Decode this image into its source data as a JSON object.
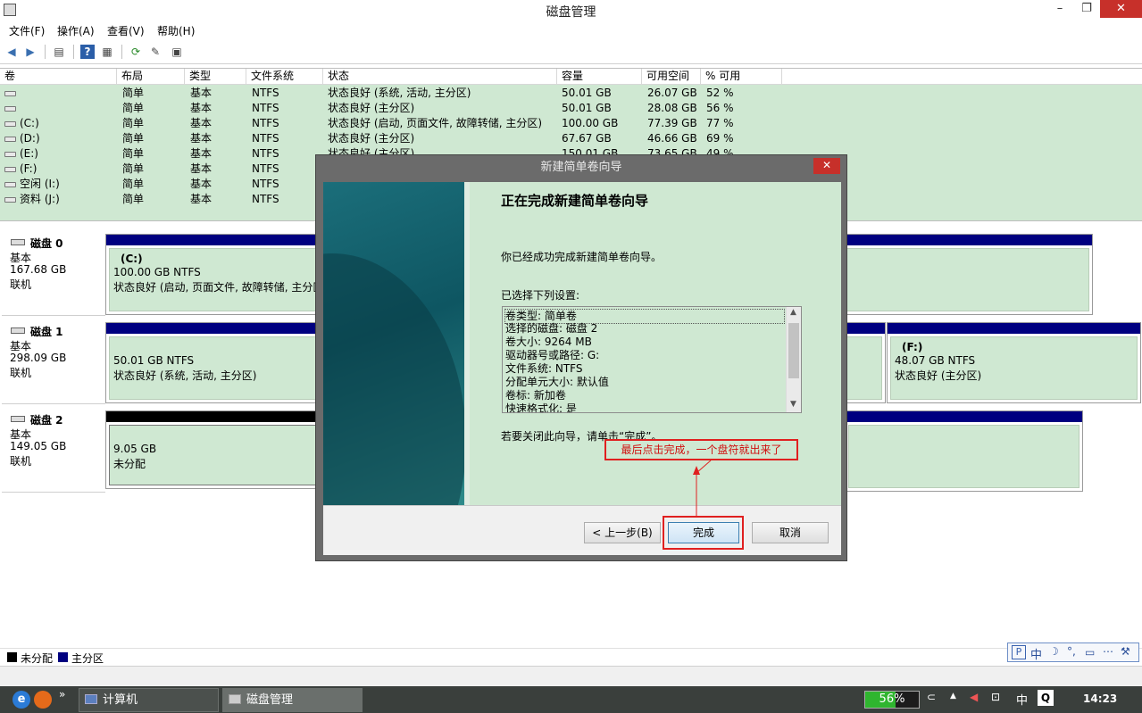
{
  "window": {
    "title": "磁盘管理",
    "minimize": "–",
    "restore": "❐",
    "close": "✕"
  },
  "menu": [
    "文件(F)",
    "操作(A)",
    "查看(V)",
    "帮助(H)"
  ],
  "toolbar_icons": [
    "back-icon",
    "forward-icon",
    "show-hide-console-tree-icon",
    "help-icon",
    "properties-icon",
    "refresh-icon",
    "export-icon",
    "properties-list-icon"
  ],
  "volume_table": {
    "columns": [
      "卷",
      "布局",
      "类型",
      "文件系统",
      "状态",
      "容量",
      "可用空间",
      "% 可用"
    ],
    "rows": [
      {
        "name": "",
        "layout": "简单",
        "type": "基本",
        "fs": "NTFS",
        "status": "状态良好 (系统, 活动, 主分区)",
        "capacity": "50.01 GB",
        "free": "26.07 GB",
        "pct": "52 %"
      },
      {
        "name": "",
        "layout": "简单",
        "type": "基本",
        "fs": "NTFS",
        "status": "状态良好 (主分区)",
        "capacity": "50.01 GB",
        "free": "28.08 GB",
        "pct": "56 %"
      },
      {
        "name": "(C:)",
        "layout": "简单",
        "type": "基本",
        "fs": "NTFS",
        "status": "状态良好 (启动, 页面文件, 故障转储, 主分区)",
        "capacity": "100.00 GB",
        "free": "77.39 GB",
        "pct": "77 %"
      },
      {
        "name": "(D:)",
        "layout": "简单",
        "type": "基本",
        "fs": "NTFS",
        "status": "状态良好 (主分区)",
        "capacity": "67.67 GB",
        "free": "46.66 GB",
        "pct": "69 %"
      },
      {
        "name": "(E:)",
        "layout": "简单",
        "type": "基本",
        "fs": "NTFS",
        "status": "状态良好 (主分区)",
        "capacity": "150.01 GB",
        "free": "73.65 GB",
        "pct": "49 %"
      },
      {
        "name": "(F:)",
        "layout": "简单",
        "type": "基本",
        "fs": "NTFS",
        "status": "",
        "capacity": "",
        "free": "",
        "pct": ""
      },
      {
        "name": "空闲 (I:)",
        "layout": "简单",
        "type": "基本",
        "fs": "NTFS",
        "status": "",
        "capacity": "",
        "free": "",
        "pct": ""
      },
      {
        "name": "资料 (J:)",
        "layout": "简单",
        "type": "基本",
        "fs": "NTFS",
        "status": "",
        "capacity": "",
        "free": "",
        "pct": ""
      }
    ]
  },
  "disks": [
    {
      "name": "磁盘 0",
      "kind": "基本",
      "size": "167.68 GB",
      "state": "联机",
      "partition": {
        "title": "(C:)",
        "size": "100.00 GB NTFS",
        "status": "状态良好 (启动, 页面文件, 故障转储, 主分区)"
      }
    },
    {
      "name": "磁盘 1",
      "kind": "基本",
      "size": "298.09 GB",
      "state": "联机",
      "partition": {
        "size": "50.01 GB NTFS",
        "status": "状态良好 (系统, 活动, 主分区)"
      },
      "partition_right": {
        "title": "(F:)",
        "size": "48.07 GB NTFS",
        "status": "状态良好 (主分区)"
      }
    },
    {
      "name": "磁盘 2",
      "kind": "基本",
      "size": "149.05 GB",
      "state": "联机",
      "partition": {
        "size": "9.05 GB",
        "status": "未分配"
      }
    }
  ],
  "legend": {
    "unallocated": "未分配",
    "primary": "主分区"
  },
  "dialog": {
    "title": "新建简单卷向导",
    "close": "✕",
    "heading": "正在完成新建简单卷向导",
    "intro": "你已经成功完成新建简单卷向导。",
    "selected_label": "已选择下列设置:",
    "settings": [
      "卷类型: 简单卷",
      "选择的磁盘: 磁盘 2",
      "卷大小: 9264 MB",
      "驱动器号或路径: G:",
      "文件系统: NTFS",
      "分配单元大小: 默认值",
      "卷标: 新加卷",
      "快速格式化: 是"
    ],
    "close_hint": "若要关闭此向导，请单击“完成”。",
    "back_button": "< 上一步(B)",
    "finish_button": "完成",
    "cancel_button": "取消"
  },
  "annotation": {
    "note": "最后点击完成，一个盘符就出来了",
    "color": "#e02020"
  },
  "ime": {
    "mode": "中"
  },
  "taskbar": {
    "buttons": [
      "计算机",
      "磁盘管理"
    ],
    "battery": "56%",
    "ime_indicator": "中",
    "clock": "14:23"
  },
  "colors": {
    "primary_partition": "#000080",
    "unallocated": "#000000",
    "healthy_bg": "#cfe8d2",
    "close_red": "#c7302a"
  }
}
